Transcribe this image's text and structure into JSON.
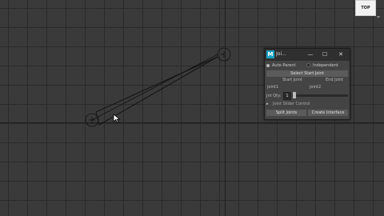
{
  "viewport": {
    "camera_label": "TOP"
  },
  "window": {
    "title": "Joi...",
    "app_icon_letter": "M",
    "controls": {
      "minimize": "—",
      "maximize": "☐",
      "close": "✕"
    },
    "radio_options": [
      {
        "label": "Auto-Parent",
        "selected": true
      },
      {
        "label": "Independent",
        "selected": false
      }
    ],
    "select_start_button": "Select Start Joint",
    "start_joint_label": "Start Joint",
    "end_joint_label": "End Joint",
    "start_joint_value": "joint1",
    "end_joint_value": "joint2",
    "joint_qty_label": "Jnt Qty:",
    "joint_qty_value": "1",
    "slider_fraction": 0.02,
    "section_label": "Joint Slider Control",
    "split_button": "Split Joints",
    "create_button": "Create Interface"
  },
  "colors": {
    "grid_bg": "#3a3a3a",
    "grid_line": "#2b2b2b",
    "joint_line": "#111111",
    "accent_icon": "#18a1c4"
  }
}
